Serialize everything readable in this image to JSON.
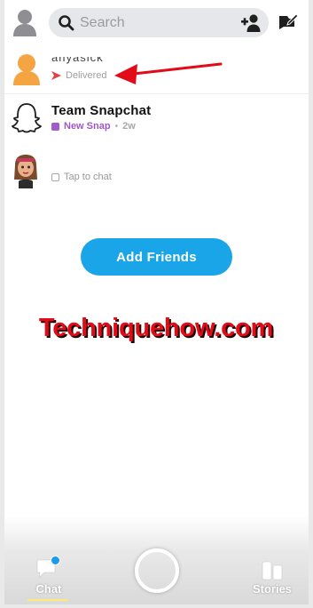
{
  "search": {
    "placeholder": "Search"
  },
  "chats": [
    {
      "name": "anyasick",
      "status": "Delivered",
      "type": "delivered"
    },
    {
      "name": "Team Snapchat",
      "status": "New Snap",
      "age": "2w",
      "type": "new-snap"
    },
    {
      "name": "",
      "status": "Tap to chat",
      "type": "tap"
    }
  ],
  "add_friends_label": "Add Friends",
  "watermark": "Techniquehow.com",
  "nav": {
    "chat_label": "Chat",
    "stories_label": "Stories"
  },
  "colors": {
    "accent_blue": "#1aa5e8",
    "snap_purple": "#a05cc8",
    "delivered_red": "#e04141",
    "annotation_red": "#e20b18"
  }
}
